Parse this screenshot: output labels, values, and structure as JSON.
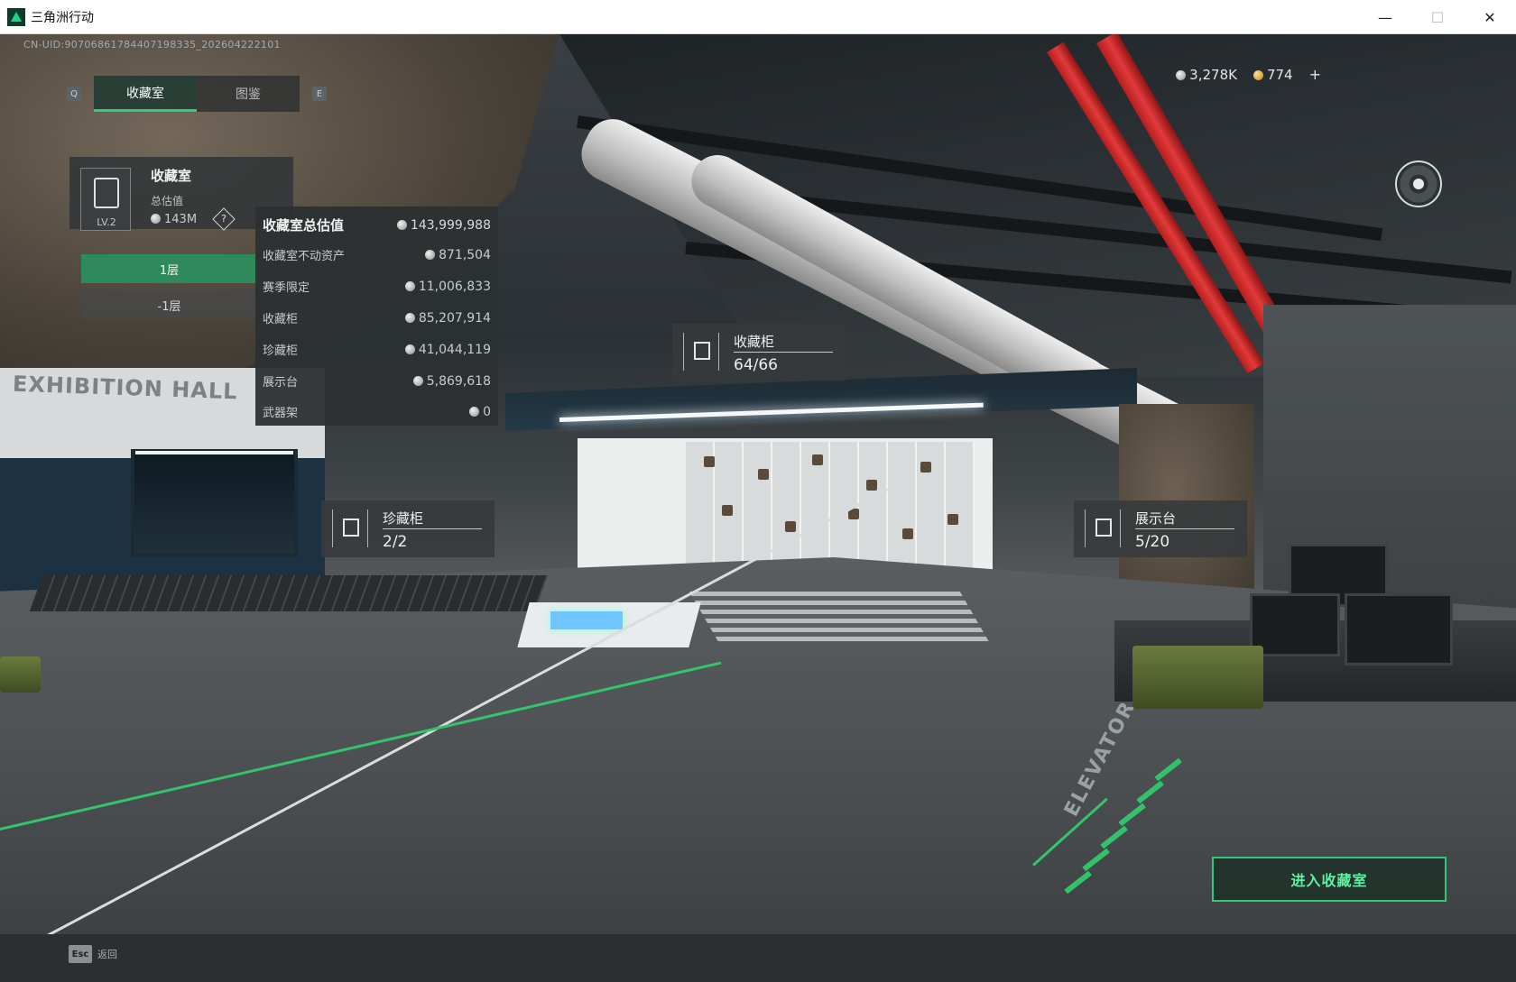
{
  "window": {
    "title": "三角洲行动",
    "minimize": "—",
    "maximize": "☐",
    "close": "✕"
  },
  "hud": {
    "uid": "CN-UID:9070686178440719833​5_202604222101",
    "currency": {
      "silver": "3,278K",
      "gold": "774",
      "add": "+"
    }
  },
  "tabs": {
    "prev_key": "Q",
    "next_key": "E",
    "items": [
      {
        "label": "收藏室",
        "active": true
      },
      {
        "label": "图鉴",
        "active": false
      }
    ]
  },
  "room": {
    "title": "收藏室",
    "subtitle": "总估值",
    "value": "143M",
    "level": "LV.2",
    "help": "?"
  },
  "floors": [
    {
      "label": "1层",
      "active": true
    },
    {
      "label": "-1层",
      "active": false
    }
  ],
  "valuation": {
    "rows": [
      {
        "label": "收藏室总估值",
        "value": "143,999,988"
      },
      {
        "label": "收藏室不动资产",
        "value": "871,504"
      },
      {
        "label": "赛季限定",
        "value": "11,006,833"
      },
      {
        "label": "收藏柜",
        "value": "85,207,914"
      },
      {
        "label": "珍藏柜",
        "value": "41,044,119"
      },
      {
        "label": "展示台",
        "value": "5,869,618"
      },
      {
        "label": "武器架",
        "value": "0"
      }
    ]
  },
  "markers": [
    {
      "name": "收藏柜",
      "count": "64/66"
    },
    {
      "name": "珍藏柜",
      "count": "2/2"
    },
    {
      "name": "展示台",
      "count": "5/20"
    }
  ],
  "scene": {
    "exhibit_sign": "EXHIBITION HALL",
    "elevator_sign": "ELEVATOR"
  },
  "actions": {
    "enter": "进入收藏室",
    "esc_key": "Esc",
    "esc_label": "返回"
  },
  "colors": {
    "accent_green": "#2ecf7b",
    "pipe_red": "#d42a2a"
  }
}
